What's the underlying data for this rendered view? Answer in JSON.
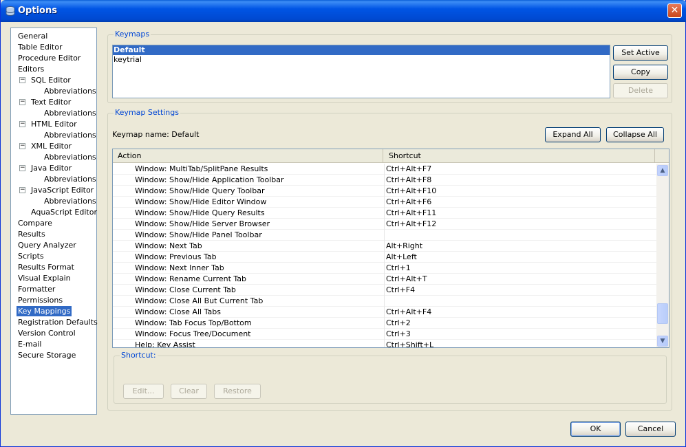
{
  "window": {
    "title": "Options"
  },
  "nav": {
    "items": [
      {
        "label": "General",
        "level": 0,
        "toggle": false
      },
      {
        "label": "Table Editor",
        "level": 0,
        "toggle": false
      },
      {
        "label": "Procedure Editor",
        "level": 0,
        "toggle": false
      },
      {
        "label": "Editors",
        "level": 0,
        "toggle": false
      },
      {
        "label": "SQL Editor",
        "level": 1,
        "toggle": true
      },
      {
        "label": "Abbreviations",
        "level": 2,
        "toggle": false
      },
      {
        "label": "Text Editor",
        "level": 1,
        "toggle": true
      },
      {
        "label": "Abbreviations",
        "level": 2,
        "toggle": false
      },
      {
        "label": "HTML Editor",
        "level": 1,
        "toggle": true
      },
      {
        "label": "Abbreviations",
        "level": 2,
        "toggle": false
      },
      {
        "label": "XML Editor",
        "level": 1,
        "toggle": true
      },
      {
        "label": "Abbreviations",
        "level": 2,
        "toggle": false
      },
      {
        "label": "Java Editor",
        "level": 1,
        "toggle": true
      },
      {
        "label": "Abbreviations",
        "level": 2,
        "toggle": false
      },
      {
        "label": "JavaScript Editor",
        "level": 1,
        "toggle": true
      },
      {
        "label": "Abbreviations",
        "level": 2,
        "toggle": false
      },
      {
        "label": "AquaScript Editor",
        "level": 1,
        "toggle": false
      },
      {
        "label": "Compare",
        "level": 0,
        "toggle": false
      },
      {
        "label": "Results",
        "level": 0,
        "toggle": false
      },
      {
        "label": "Query Analyzer",
        "level": 0,
        "toggle": false
      },
      {
        "label": "Scripts",
        "level": 0,
        "toggle": false
      },
      {
        "label": "Results Format",
        "level": 0,
        "toggle": false
      },
      {
        "label": "Visual Explain",
        "level": 0,
        "toggle": false
      },
      {
        "label": "Formatter",
        "level": 0,
        "toggle": false
      },
      {
        "label": "Permissions",
        "level": 0,
        "toggle": false
      },
      {
        "label": "Key Mappings",
        "level": 0,
        "toggle": false,
        "selected": true
      },
      {
        "label": "Registration Defaults",
        "level": 0,
        "toggle": false
      },
      {
        "label": "Version Control",
        "level": 0,
        "toggle": false
      },
      {
        "label": "E-mail",
        "level": 0,
        "toggle": false
      },
      {
        "label": "Secure Storage",
        "level": 0,
        "toggle": false
      }
    ],
    "toggle_glyph": "−"
  },
  "keymaps": {
    "legend": "Keymaps",
    "items": [
      {
        "label": "Default",
        "selected": true
      },
      {
        "label": "keytrial",
        "selected": false
      }
    ],
    "set_active": "Set Active",
    "copy": "Copy",
    "delete": "Delete"
  },
  "settings": {
    "legend": "Keymap Settings",
    "keymap_name": "Keymap name: Default",
    "expand_all": "Expand All",
    "collapse_all": "Collapse All",
    "columns": [
      "Action",
      "Shortcut"
    ],
    "rows": [
      {
        "action": "Window: MultiTab/SplitPane Results",
        "shortcut": "Ctrl+Alt+F7"
      },
      {
        "action": "Window: Show/Hide Application Toolbar",
        "shortcut": "Ctrl+Alt+F8"
      },
      {
        "action": "Window: Show/Hide Query Toolbar",
        "shortcut": "Ctrl+Alt+F10"
      },
      {
        "action": "Window: Show/Hide Editor Window",
        "shortcut": "Ctrl+Alt+F6"
      },
      {
        "action": "Window: Show/Hide Query Results",
        "shortcut": "Ctrl+Alt+F11"
      },
      {
        "action": "Window: Show/Hide Server Browser",
        "shortcut": "Ctrl+Alt+F12"
      },
      {
        "action": "Window: Show/Hide Panel Toolbar",
        "shortcut": ""
      },
      {
        "action": "Window: Next Tab",
        "shortcut": "Alt+Right"
      },
      {
        "action": "Window: Previous Tab",
        "shortcut": "Alt+Left"
      },
      {
        "action": "Window: Next Inner Tab",
        "shortcut": "Ctrl+1"
      },
      {
        "action": "Window: Rename Current Tab",
        "shortcut": "Ctrl+Alt+T"
      },
      {
        "action": "Window: Close Current Tab",
        "shortcut": "Ctrl+F4"
      },
      {
        "action": "Window: Close All But Current Tab",
        "shortcut": ""
      },
      {
        "action": "Window: Close All Tabs",
        "shortcut": "Ctrl+Alt+F4"
      },
      {
        "action": "Window: Tab Focus Top/Bottom",
        "shortcut": "Ctrl+2"
      },
      {
        "action": "Window: Focus Tree/Document",
        "shortcut": "Ctrl+3"
      },
      {
        "action": "Help: Key Assist",
        "shortcut": "Ctrl+Shift+L"
      }
    ]
  },
  "shortcut": {
    "legend": "Shortcut:",
    "edit": "Edit...",
    "clear": "Clear",
    "restore": "Restore"
  },
  "footer": {
    "ok": "OK",
    "cancel": "Cancel"
  },
  "colors": {
    "selection": "#316ac5",
    "titlebar": "#0055e5",
    "legend": "#0046d5",
    "face": "#ece9d8"
  }
}
